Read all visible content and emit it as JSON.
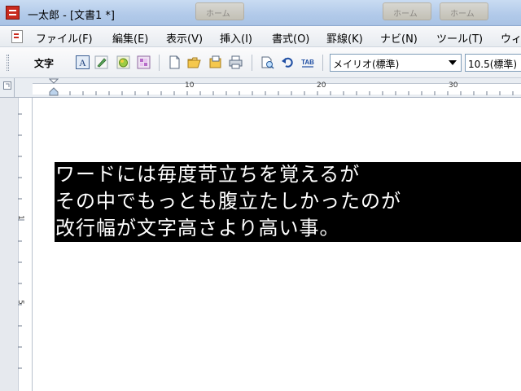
{
  "window": {
    "title": "一太郎 - [文書1 *]",
    "task_buttons": [
      "ホーム",
      "ホーム",
      "ホーム"
    ]
  },
  "menu": {
    "items": [
      "ファイル(F)",
      "編集(E)",
      "表示(V)",
      "挿入(I)",
      "書式(O)",
      "罫線(K)",
      "ナビ(N)",
      "ツール(T)",
      "ウィ"
    ]
  },
  "toolbar": {
    "label": "文字",
    "font_name": "メイリオ(標準)",
    "font_size": "10.5(標準)",
    "icons": [
      "text-frame-icon",
      "pen-icon",
      "highlight-icon",
      "pattern-icon",
      "new-doc-icon",
      "open-folder-icon",
      "save-icon",
      "print-icon",
      "preview-icon",
      "undo-icon",
      "tab-icon"
    ]
  },
  "ruler": {
    "top_numbers": [
      "10",
      "20",
      "30"
    ],
    "left_numbers": [
      "1",
      "5"
    ]
  },
  "document": {
    "lines": [
      "ワードには毎度苛立ちを覚えるが",
      "その中でもっとも腹立たしかったのが",
      "改行幅が文字高さより高い事。"
    ]
  },
  "colors": {
    "selection_bg": "#000000",
    "selection_text": "#ffffff",
    "titlebar": "#b3cbea"
  }
}
